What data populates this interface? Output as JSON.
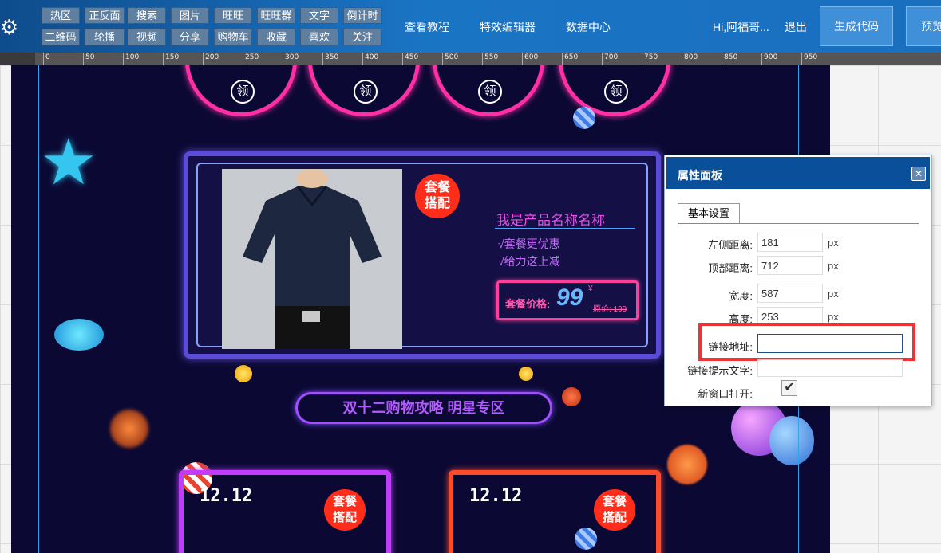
{
  "toolbar": {
    "row1": [
      "热区",
      "正反面",
      "搜索",
      "图片",
      "旺旺",
      "旺旺群",
      "文字",
      "倒计时"
    ],
    "row2": [
      "二维码",
      "轮播",
      "视频",
      "分享",
      "购物车",
      "收藏",
      "喜欢",
      "关注"
    ]
  },
  "nav": {
    "tutorial": "查看教程",
    "effect_editor": "特效编辑器",
    "data_center": "数据中心",
    "greeting": "Hi,阿福哥...",
    "logout": "退出",
    "generate_code": "生成代码",
    "preview": "预览"
  },
  "ruler": {
    "labels": [
      "0",
      "50",
      "100",
      "150",
      "200",
      "250",
      "300",
      "350",
      "400",
      "450",
      "500",
      "550",
      "600",
      "650",
      "700",
      "750",
      "800",
      "850",
      "900",
      "950"
    ]
  },
  "design": {
    "coupon_label": "领",
    "badge_text_1": "套餐",
    "badge_text_2": "搭配",
    "product_name": "我是产品名称名称",
    "perk_1": "√套餐更优惠",
    "perk_2": "√给力这上减",
    "price_label": "套餐价格:",
    "price_value": "99",
    "price_currency": "¥",
    "original_price": "原价: 199",
    "banner_text": "双十二购物攻略 明星专区",
    "card_date": "12.12"
  },
  "panel": {
    "title": "属性面板",
    "tab_basic": "基本设置",
    "left_label": "左侧距离:",
    "left_value": "181",
    "top_label": "顶部距离:",
    "top_value": "712",
    "width_label": "宽度:",
    "width_value": "587",
    "height_label": "高度:",
    "height_value": "253",
    "unit": "px",
    "link_label": "链接地址:",
    "link_value": "",
    "hint_label": "链接提示文字:",
    "hint_value": "",
    "new_window_label": "新窗口打开:",
    "new_window_checked": true
  }
}
